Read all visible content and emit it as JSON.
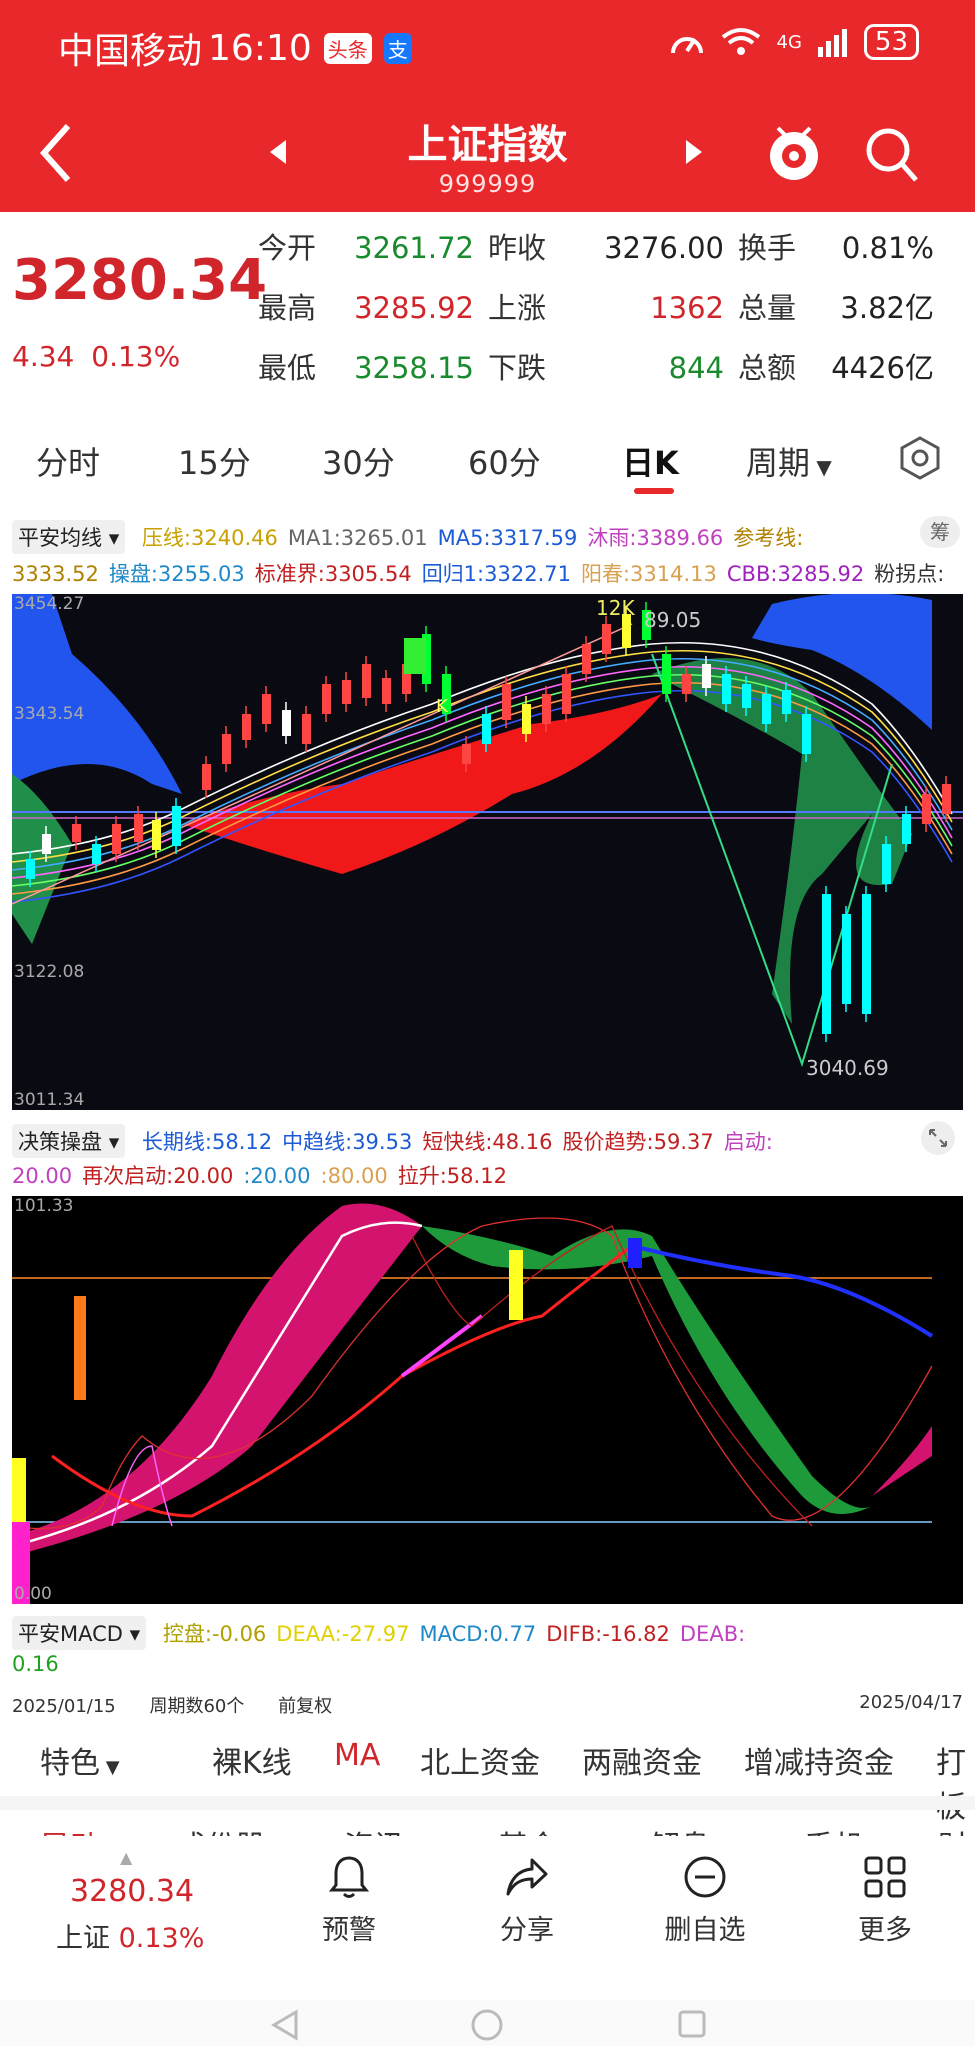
{
  "status": {
    "carrier": "中国移动",
    "time": "16:10",
    "badge1": "头条",
    "badge2": "支",
    "network": "4G",
    "battery": "53"
  },
  "header": {
    "title": "上证指数",
    "code": "999999"
  },
  "quote": {
    "price": "3280.34",
    "change": "4.34",
    "change_pct": "0.13%",
    "rows": [
      [
        {
          "l": "今开"
        },
        {
          "v": "3261.72",
          "c": "green"
        },
        {
          "l": "昨收"
        },
        {
          "v": "3276.00",
          "c": "k"
        },
        {
          "l": "换手"
        },
        {
          "v": "0.81%",
          "c": "k"
        }
      ],
      [
        {
          "l": "最高"
        },
        {
          "v": "3285.92",
          "c": "red"
        },
        {
          "l": "上涨"
        },
        {
          "v": "1362",
          "c": "red"
        },
        {
          "l": "总量"
        },
        {
          "v": "3.82亿",
          "c": "k"
        }
      ],
      [
        {
          "l": "最低"
        },
        {
          "v": "3258.15",
          "c": "green"
        },
        {
          "l": "下跌"
        },
        {
          "v": "844",
          "c": "green"
        },
        {
          "l": "总额"
        },
        {
          "v": "4426亿",
          "c": "k"
        }
      ]
    ]
  },
  "period_tabs": [
    "分时",
    "15分",
    "30分",
    "60分",
    "日K",
    "周期"
  ],
  "active_period": "日K",
  "main_indicator": {
    "name": "平安均线",
    "items": [
      {
        "t": "压线:",
        "v": "3240.46",
        "c": "#c8a000"
      },
      {
        "t": "MA1:",
        "v": "3265.01",
        "c": "#666666"
      },
      {
        "t": "MA5:",
        "v": "3317.59",
        "c": "#1c5bd6"
      },
      {
        "t": "沐雨:",
        "v": "3389.66",
        "c": "#c040c0"
      },
      {
        "t": "参考线:",
        "v": "",
        "c": "#b08000"
      }
    ],
    "items2": [
      {
        "t": "",
        "v": "3333.52",
        "c": "#b08000"
      },
      {
        "t": "操盘:",
        "v": "3255.03",
        "c": "#1e88c8"
      },
      {
        "t": "标准界:",
        "v": "3305.54",
        "c": "#c02020"
      },
      {
        "t": "回归1:",
        "v": "3322.71",
        "c": "#1c5bd6"
      },
      {
        "t": "阳春:",
        "v": "3314.13",
        "c": "#d9a050"
      },
      {
        "t": "CBB:",
        "v": "3285.92",
        "c": "#a020c0"
      },
      {
        "t": "粉拐点:",
        "v": "",
        "c": "#333333"
      }
    ],
    "side_button": "筹"
  },
  "kline_axis": {
    "top": "3454.27",
    "mid": "3343.54",
    "low": "3122.08",
    "bottom": "3011.34",
    "marker_high": "12K",
    "marker_high_val": "89.05",
    "marker_low": "3040.69",
    "marker_mid": "K"
  },
  "sub_indicator": {
    "name": "决策操盘",
    "items": [
      {
        "t": "长期线:",
        "v": "58.12",
        "c": "#1c5bd6"
      },
      {
        "t": "中趋线:",
        "v": "39.53",
        "c": "#1c5bd6"
      },
      {
        "t": "短快线:",
        "v": "48.16",
        "c": "#c02020"
      },
      {
        "t": "股价趋势:",
        "v": "59.37",
        "c": "#c02020"
      },
      {
        "t": "启动:",
        "v": "",
        "c": "#c040c0"
      }
    ],
    "items2": [
      {
        "t": "",
        "v": "20.00",
        "c": "#c040c0"
      },
      {
        "t": "再次启动:",
        "v": "20.00",
        "c": "#c02020"
      },
      {
        "t": "",
        "v": ":20.00",
        "c": "#1e88c8"
      },
      {
        "t": "",
        "v": ":80.00",
        "c": "#d9a050"
      },
      {
        "t": "拉升:",
        "v": "58.12",
        "c": "#c02020"
      }
    ],
    "axis_top": "101.33",
    "axis_bottom": "0.00"
  },
  "macd": {
    "name": "平安MACD",
    "items": [
      {
        "t": "控盘:",
        "v": "-0.06",
        "c": "#b0a000"
      },
      {
        "t": "DEAA:",
        "v": "-27.97",
        "c": "#e0d000"
      },
      {
        "t": "MACD:",
        "v": "0.77",
        "c": "#1e88c8"
      },
      {
        "t": "DIFB:",
        "v": "-16.82",
        "c": "#c02020"
      },
      {
        "t": "DEAB:",
        "v": "",
        "c": "#c040c0"
      }
    ],
    "items2": [
      {
        "t": "",
        "v": "0.16",
        "c": "#20a020"
      }
    ]
  },
  "dates": {
    "start": "2025/01/15",
    "period_count": "周期数60个",
    "adjust": "前复权",
    "end": "2025/04/17"
  },
  "feature_tabs": [
    "特色",
    "裸K线",
    "MA",
    "北上资金",
    "两融资金",
    "增减持资金",
    "打板"
  ],
  "active_feature": "MA",
  "cut_tabs": [
    "异动",
    "成份股",
    "资讯",
    "基金",
    "解盘",
    "手机",
    "财"
  ],
  "bottom_bar": {
    "price": "3280.34",
    "name": "上证",
    "pct": "0.13%",
    "items": [
      "预警",
      "分享",
      "删自选",
      "更多"
    ]
  }
}
